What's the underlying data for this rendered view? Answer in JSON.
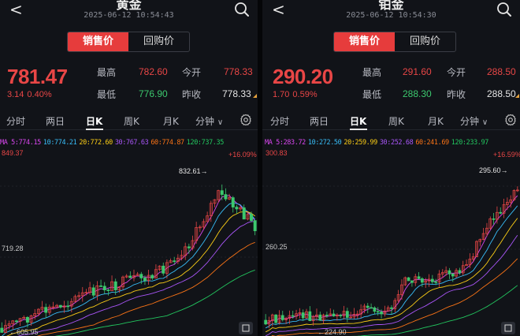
{
  "left": {
    "title": "黄金",
    "timestamp": "2025-06-12 10:54:43",
    "toggle": {
      "sell": "销售价",
      "buyback": "回购价"
    },
    "price": "781.47",
    "change": "3.14",
    "change_pct": "0.40%",
    "stats": {
      "high_label": "最高",
      "high": "782.60",
      "open_label": "今开",
      "open": "778.33",
      "low_label": "最低",
      "low": "776.90",
      "prev_label": "昨收",
      "prev": "778.33"
    },
    "tabs": [
      "分时",
      "两日",
      "日K",
      "周K",
      "月K",
      "分钟"
    ],
    "ma": {
      "ma5": "MA 5:774.15",
      "ma10": "10:774.21",
      "ma20": "20:772.60",
      "ma30": "30:767.63",
      "ma60": "60:774.87",
      "ma120": "120:737.35"
    },
    "axis": {
      "top": "849.37",
      "mid": "719.28",
      "bottom": "605.95",
      "peak": "832.61",
      "pct": "+16.09%"
    },
    "colors": {
      "ma5": "#d946ef",
      "ma10": "#38bdf8",
      "ma20": "#facc15",
      "ma30": "#a855f7",
      "ma60": "#f97316",
      "ma120": "#22c55e"
    }
  },
  "right": {
    "title": "铂金",
    "timestamp": "2025-06-12 10:54:30",
    "toggle": {
      "sell": "销售价",
      "buyback": "回购价"
    },
    "price": "290.20",
    "change": "1.70",
    "change_pct": "0.59%",
    "stats": {
      "high_label": "最高",
      "high": "291.60",
      "open_label": "今开",
      "open": "288.50",
      "low_label": "最低",
      "low": "288.30",
      "prev_label": "昨收",
      "prev": "288.50"
    },
    "tabs": [
      "分时",
      "两日",
      "日K",
      "周K",
      "月K",
      "分钟"
    ],
    "ma": {
      "ma5": "MA 5:283.72",
      "ma10": "10:272.50",
      "ma20": "20:259.99",
      "ma30": "30:252.68",
      "ma60": "60:241.69",
      "ma120": "120:233.97"
    },
    "axis": {
      "top": "300.83",
      "mid": "260.25",
      "bottom": "224.90",
      "peak": "295.60",
      "pct": "+16.59%"
    }
  }
}
